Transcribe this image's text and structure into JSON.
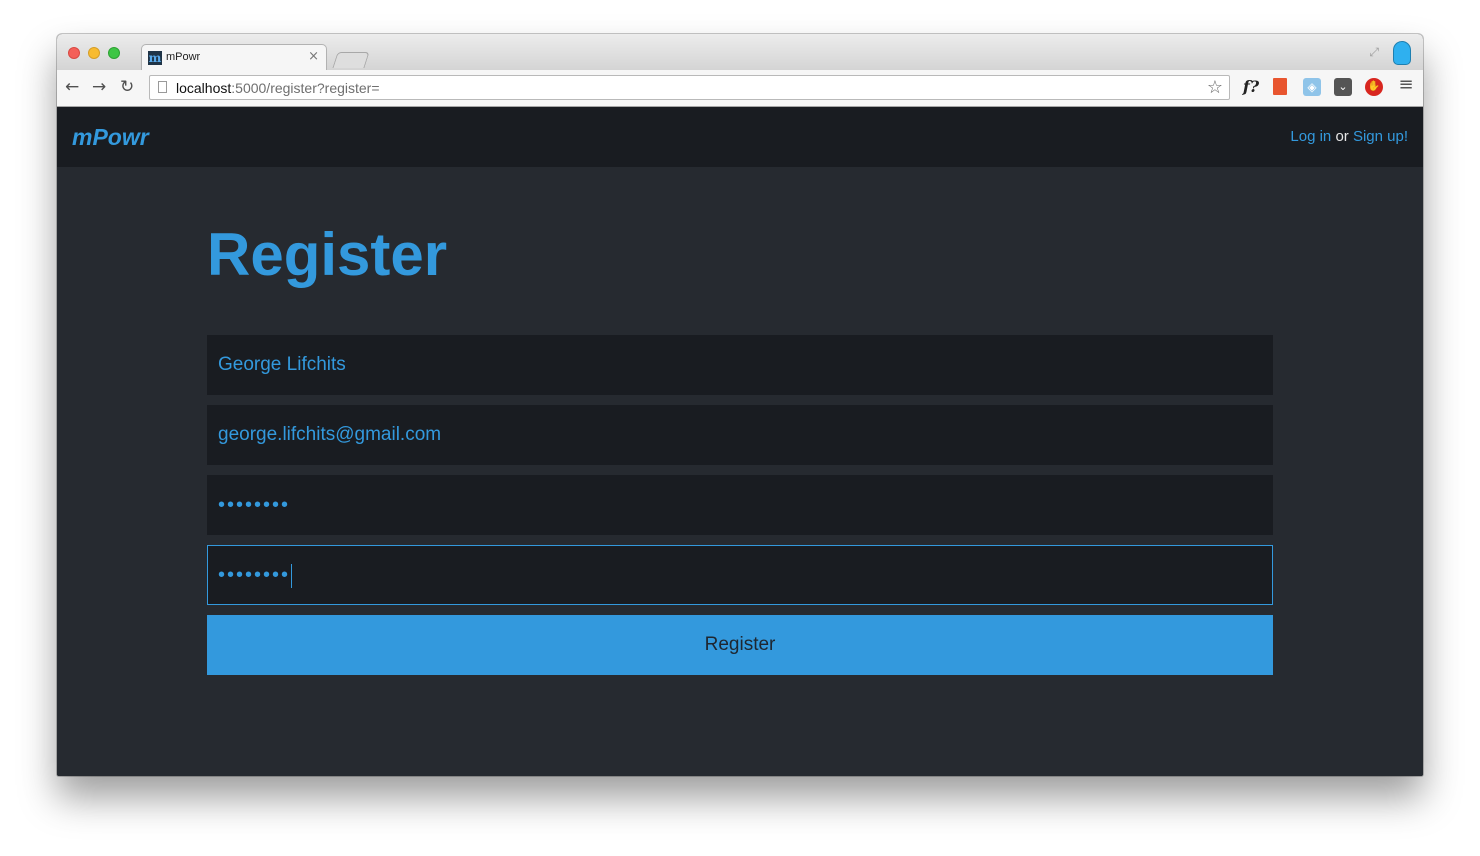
{
  "browser": {
    "tab_title": "mPowr",
    "tab_favicon_letter": "m",
    "tab_close": "×",
    "url_host": "localhost",
    "url_rest": ":5000/register?register=",
    "icons": [
      "back-icon",
      "forward-icon",
      "reload-icon",
      "page-icon",
      "star-icon",
      "font-finder-icon",
      "bookmark-icon",
      "shield-icon",
      "pocket-icon",
      "adblock-icon",
      "menu-icon",
      "fullscreen-icon",
      "profile-icon"
    ],
    "ext_font_label": "f?"
  },
  "navbar": {
    "brand": "mPowr",
    "login_label": "Log in",
    "or_label": "or",
    "signup_label": "Sign up!"
  },
  "main": {
    "heading": "Register",
    "name_value": "George Lifchits",
    "email_value": "george.lifchits@gmail.com",
    "password_mask": "••••••••",
    "confirm_mask": "••••••••",
    "submit_label": "Register"
  },
  "colors": {
    "accent": "#3399dd",
    "page_bg": "#262a30",
    "navbar_bg": "#191c21",
    "input_bg": "#191c21"
  }
}
